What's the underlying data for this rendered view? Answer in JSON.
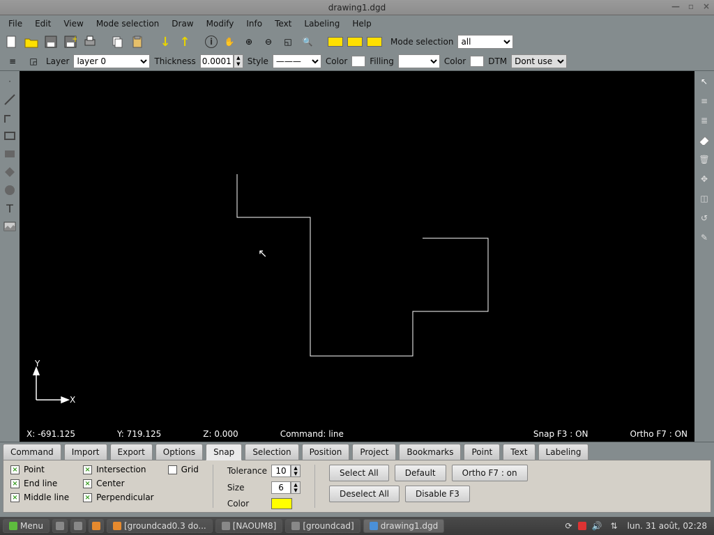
{
  "window": {
    "title": "drawing1.dgd"
  },
  "menu": [
    "File",
    "Edit",
    "View",
    "Mode selection",
    "Draw",
    "Modify",
    "Info",
    "Text",
    "Labeling",
    "Help"
  ],
  "toolbar1": {
    "mode_label": "Mode selection",
    "mode_value": "all"
  },
  "toolbar2": {
    "layer_label": "Layer",
    "layer_value": "layer 0",
    "thickness_label": "Thickness",
    "thickness_value": "0.0001",
    "style_label": "Style",
    "color_label": "Color",
    "filling_label": "Filling",
    "color2_label": "Color",
    "dtm_label": "DTM",
    "dtm_value": "Dont use"
  },
  "status": {
    "x": "X: -691.125",
    "y": "Y: 719.125",
    "z": "Z: 0.000",
    "command": "Command: line",
    "snap": "Snap F3 : ON",
    "ortho": "Ortho F7 : ON"
  },
  "tabs": [
    "Command",
    "Import",
    "Export",
    "Options",
    "Snap",
    "Selection",
    "Position",
    "Project",
    "Bookmarks",
    "Point",
    "Text",
    "Labeling"
  ],
  "tabs_active": 4,
  "snap_panel": {
    "col1": [
      {
        "label": "Point",
        "on": true
      },
      {
        "label": "End line",
        "on": true
      },
      {
        "label": "Middle line",
        "on": true
      }
    ],
    "col2": [
      {
        "label": "Intersection",
        "on": true
      },
      {
        "label": "Center",
        "on": true
      },
      {
        "label": "Perpendicular",
        "on": true
      }
    ],
    "col3": [
      {
        "label": "Grid",
        "on": false
      }
    ],
    "tol_label": "Tolerance",
    "tol_value": "10",
    "size_label": "Size",
    "size_value": "6",
    "color_label": "Color",
    "buttons": {
      "select_all": "Select All",
      "default": "Default",
      "ortho": "Ortho F7 : on",
      "deselect": "Deselect All",
      "disable": "Disable  F3"
    }
  },
  "taskbar": {
    "menu": "Menu",
    "items": [
      {
        "label": "[groundcad0.3 do..."
      },
      {
        "label": "[NAOUM8]"
      },
      {
        "label": "[groundcad]"
      },
      {
        "label": "drawing1.dgd",
        "active": true
      }
    ],
    "clock": "lun. 31 août, 02:28"
  },
  "axes": {
    "y": "Y",
    "x": "X"
  }
}
